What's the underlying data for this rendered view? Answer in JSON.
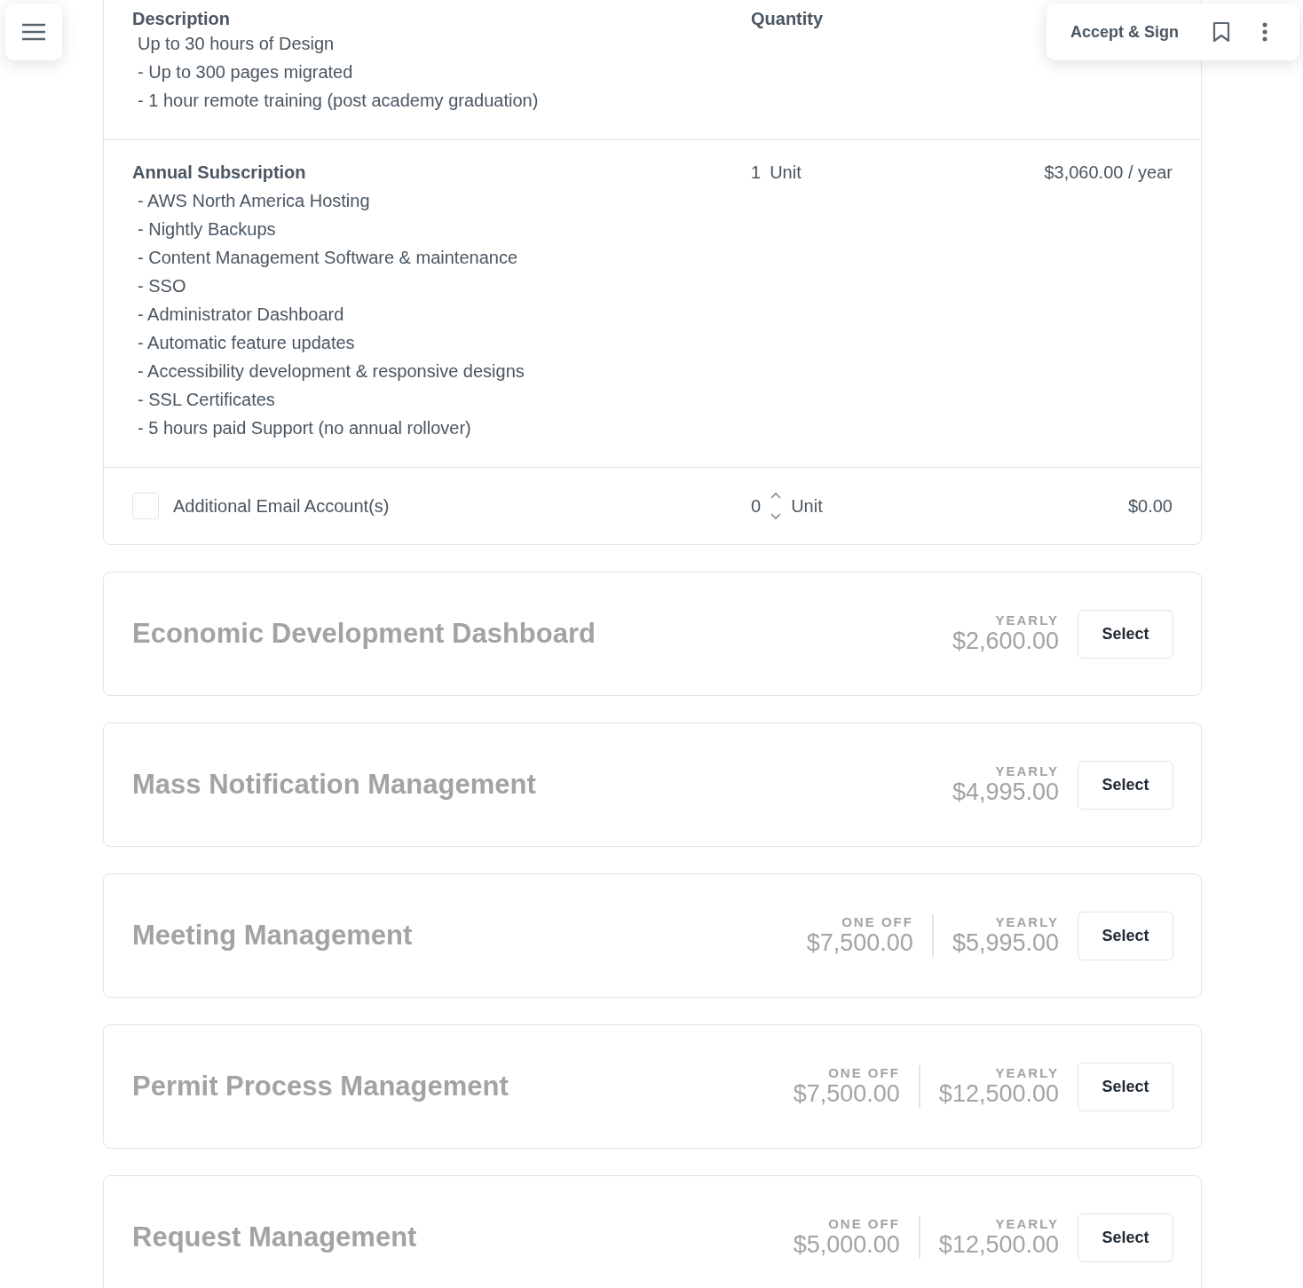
{
  "toolbar": {
    "accept_label": "Accept & Sign"
  },
  "table": {
    "columns": [
      "Description",
      "Quantity"
    ],
    "rows": [
      {
        "kind": "lines",
        "lines": [
          "Up to 30 hours of Design",
          "- Up to 300 pages migrated",
          "- 1 hour remote training (post academy graduation)"
        ]
      },
      {
        "kind": "item",
        "title": "Annual Subscription",
        "lines": [
          "- AWS North America Hosting",
          "- Nightly Backups",
          "- Content Management Software & maintenance",
          "- SSO",
          "- Administrator Dashboard",
          "- Automatic feature updates",
          "- Accessibility development & responsive designs",
          "- SSL Certificates",
          "- 5 hours paid Support (no annual rollover)"
        ],
        "quantity": "1",
        "unit": "Unit",
        "price": "$3,060.00 / year"
      },
      {
        "kind": "optional",
        "checked": false,
        "label": "Additional Email Account(s)",
        "quantity": "0",
        "unit": "Unit",
        "price": "$0.00"
      }
    ]
  },
  "products": [
    {
      "name": "Economic Development Dashboard",
      "prices": [
        {
          "label": "YEARLY",
          "amount": "$2,600.00"
        }
      ],
      "button": "Select"
    },
    {
      "name": "Mass Notification Management",
      "prices": [
        {
          "label": "YEARLY",
          "amount": "$4,995.00"
        }
      ],
      "button": "Select"
    },
    {
      "name": "Meeting Management",
      "prices": [
        {
          "label": "ONE OFF",
          "amount": "$7,500.00"
        },
        {
          "label": "YEARLY",
          "amount": "$5,995.00"
        }
      ],
      "button": "Select"
    },
    {
      "name": "Permit Process Management",
      "prices": [
        {
          "label": "ONE OFF",
          "amount": "$7,500.00"
        },
        {
          "label": "YEARLY",
          "amount": "$12,500.00"
        }
      ],
      "button": "Select"
    },
    {
      "name": "Request Management",
      "prices": [
        {
          "label": "ONE OFF",
          "amount": "$5,000.00"
        },
        {
          "label": "YEARLY",
          "amount": "$12,500.00"
        }
      ],
      "button": "Select"
    }
  ]
}
